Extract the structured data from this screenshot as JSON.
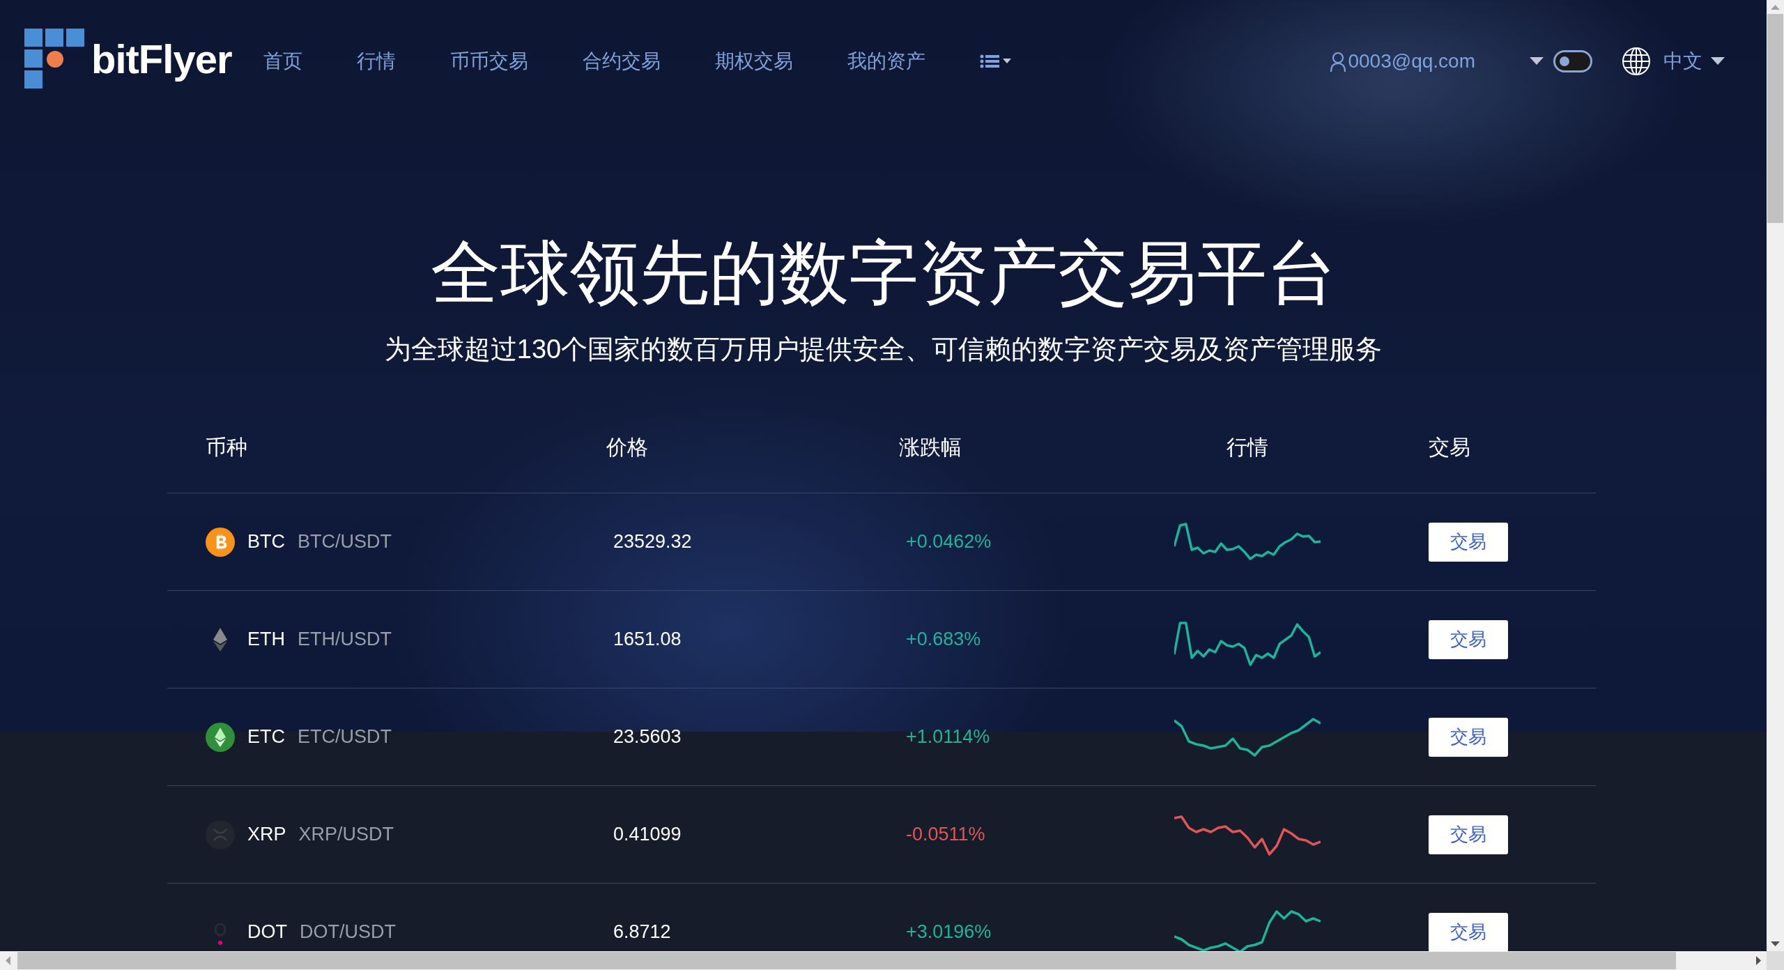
{
  "header": {
    "logo_text": "bitFlyer",
    "nav": [
      {
        "label": "首页"
      },
      {
        "label": "行情"
      },
      {
        "label": "币币交易"
      },
      {
        "label": "合约交易"
      },
      {
        "label": "期权交易"
      },
      {
        "label": "我的资产"
      }
    ],
    "user": "0003@qq.com",
    "theme_toggle": {
      "on": false
    },
    "language": "中文"
  },
  "hero": {
    "title": "全球领先的数字资产交易平台",
    "subtitle": "为全球超过130个国家的数百万用户提供安全、可信赖的数字资产交易及资产管理服务"
  },
  "table": {
    "columns": [
      "币种",
      "价格",
      "涨跌幅",
      "行情",
      "交易"
    ],
    "rows": [
      {
        "symbol": "BTC",
        "pair": "BTC/USDT",
        "price": "23529.32",
        "change": "+0.0462%",
        "color": "#1fb39a",
        "action": "交易"
      },
      {
        "symbol": "ETH",
        "pair": "ETH/USDT",
        "price": "1651.08",
        "change": "+0.683%",
        "color": "#1fb39a",
        "action": "交易"
      },
      {
        "symbol": "ETC",
        "pair": "ETC/USDT",
        "price": "23.5603",
        "change": "+1.0114%",
        "color": "#1fb39a",
        "action": "交易"
      },
      {
        "symbol": "XRP",
        "pair": "XRP/USDT",
        "price": "0.41099",
        "change": "-0.0511%",
        "color": "#e05656",
        "action": "交易"
      },
      {
        "symbol": "DOT",
        "pair": "DOT/USDT",
        "price": "6.8712",
        "change": "+3.0196%",
        "color": "#1fb39a",
        "action": "交易"
      }
    ]
  }
}
